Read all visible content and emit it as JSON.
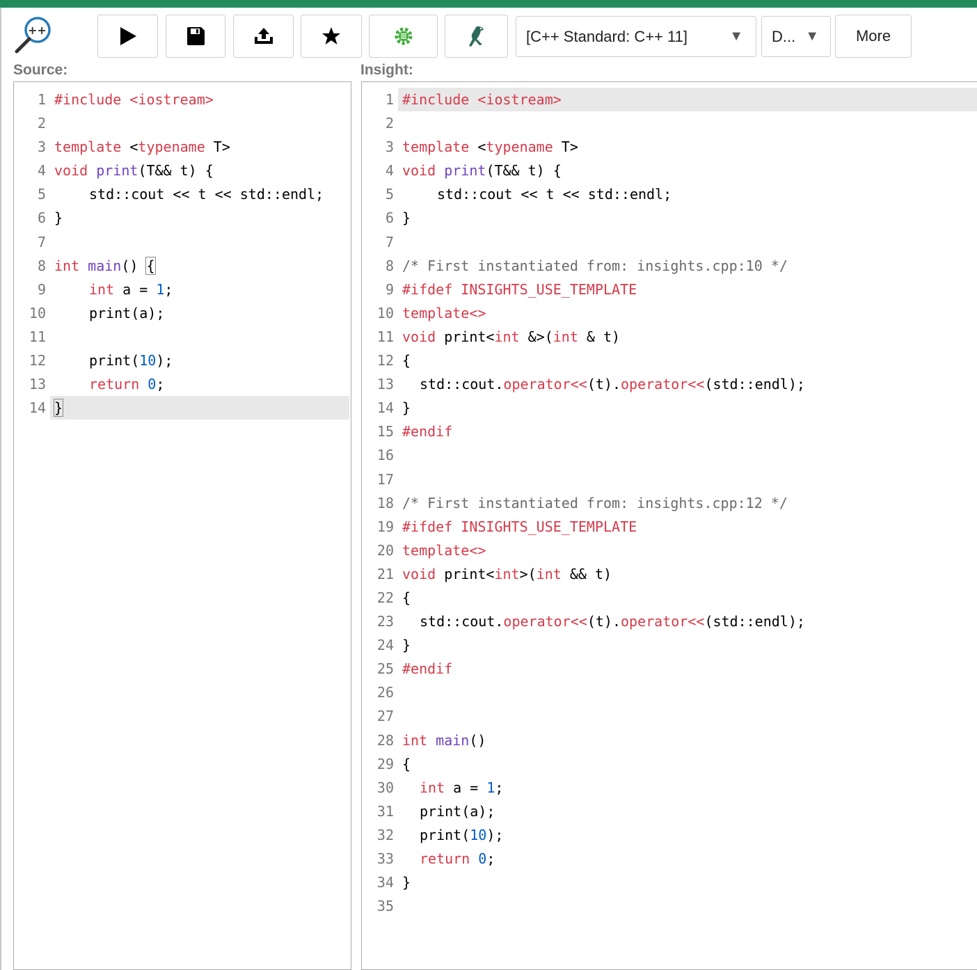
{
  "toolbar": {
    "run_title": "Run",
    "save_title": "Save",
    "share_title": "Share",
    "favorite_title": "Favorite",
    "settings_title": "Settings",
    "cppinsights_title": "C++ Insights",
    "standard_select": "[C++ Standard: C++ 11]",
    "options_select": "D...",
    "more_label": "More",
    "accent_color": "#3fae3a"
  },
  "source": {
    "title": "Source:",
    "line_numbers": [
      "1",
      "2",
      "3",
      "4",
      "5",
      "6",
      "7",
      "8",
      "9",
      "10",
      "11",
      "12",
      "13",
      "14"
    ]
  },
  "insight": {
    "title": "Insight:",
    "line_numbers": [
      "1",
      "2",
      "3",
      "4",
      "5",
      "6",
      "7",
      "8",
      "9",
      "10",
      "11",
      "12",
      "13",
      "14",
      "15",
      "16",
      "17",
      "18",
      "19",
      "20",
      "21",
      "22",
      "23",
      "24",
      "25",
      "26",
      "27",
      "28",
      "29",
      "30",
      "31",
      "32",
      "33",
      "34",
      "35"
    ]
  },
  "code": {
    "include": "#include <iostream>",
    "template": "template",
    "typename": "typename",
    "T_close": " T>",
    "void": "void",
    "print": "print",
    "print_sig_rest": "(T&& t) {",
    "cout_line": "std::cout << t << std::endl;",
    "close_brace": "}",
    "open_brace": "{",
    "int": "int",
    "main": "main",
    "main_parens": "()",
    "a_eq": " a = ",
    "one": "1",
    "semi": ";",
    "print_a": "print(a);",
    "print_open": "print(",
    "ten": "10",
    "close_paren_semi": ");",
    "return": "return",
    "zero": "0",
    "comment_10": "/* First instantiated from: insights.cpp:10 */",
    "comment_12": "/* First instantiated from: insights.cpp:12 */",
    "ifdef": "#ifdef INSIGHTS_USE_TEMPLATE",
    "template_empty": "template<>",
    "endif": "#endif",
    "print_int_ref_name": "print<",
    "int_ref_mid": " &>(",
    "int_ref_end": " & t)",
    "int_rref_mid": ">(",
    "int_rref_end": " && t)",
    "cout_start": "std::cout.",
    "operator_ll": "operator<<",
    "t_paren_dot": "(t).",
    "endl_end": "(std::endl);",
    "lt": "<",
    "space": " "
  }
}
